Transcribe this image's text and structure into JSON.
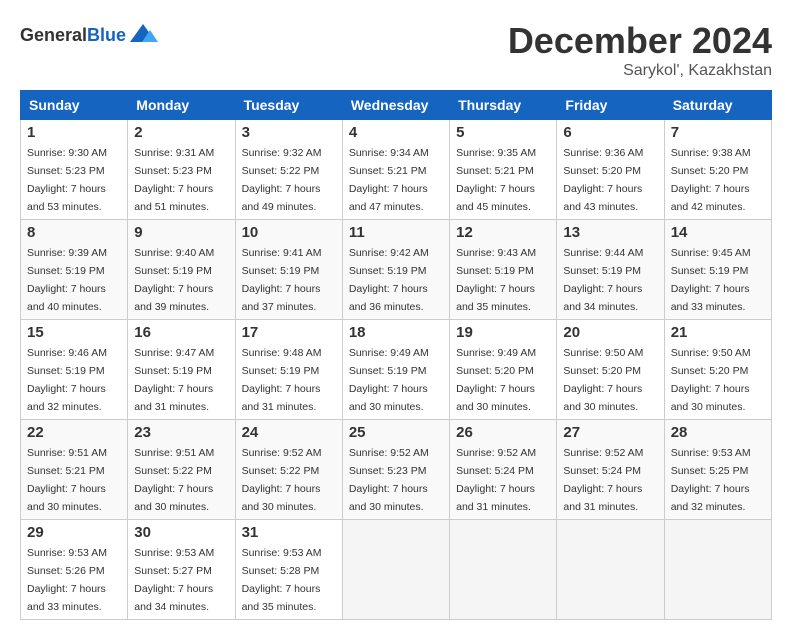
{
  "header": {
    "logo_general": "General",
    "logo_blue": "Blue",
    "title": "December 2024",
    "subtitle": "Sarykol', Kazakhstan"
  },
  "days_of_week": [
    "Sunday",
    "Monday",
    "Tuesday",
    "Wednesday",
    "Thursday",
    "Friday",
    "Saturday"
  ],
  "weeks": [
    [
      {
        "day": "1",
        "sunrise": "9:30 AM",
        "sunset": "5:23 PM",
        "daylight": "7 hours and 53 minutes."
      },
      {
        "day": "2",
        "sunrise": "9:31 AM",
        "sunset": "5:23 PM",
        "daylight": "7 hours and 51 minutes."
      },
      {
        "day": "3",
        "sunrise": "9:32 AM",
        "sunset": "5:22 PM",
        "daylight": "7 hours and 49 minutes."
      },
      {
        "day": "4",
        "sunrise": "9:34 AM",
        "sunset": "5:21 PM",
        "daylight": "7 hours and 47 minutes."
      },
      {
        "day": "5",
        "sunrise": "9:35 AM",
        "sunset": "5:21 PM",
        "daylight": "7 hours and 45 minutes."
      },
      {
        "day": "6",
        "sunrise": "9:36 AM",
        "sunset": "5:20 PM",
        "daylight": "7 hours and 43 minutes."
      },
      {
        "day": "7",
        "sunrise": "9:38 AM",
        "sunset": "5:20 PM",
        "daylight": "7 hours and 42 minutes."
      }
    ],
    [
      {
        "day": "8",
        "sunrise": "9:39 AM",
        "sunset": "5:19 PM",
        "daylight": "7 hours and 40 minutes."
      },
      {
        "day": "9",
        "sunrise": "9:40 AM",
        "sunset": "5:19 PM",
        "daylight": "7 hours and 39 minutes."
      },
      {
        "day": "10",
        "sunrise": "9:41 AM",
        "sunset": "5:19 PM",
        "daylight": "7 hours and 37 minutes."
      },
      {
        "day": "11",
        "sunrise": "9:42 AM",
        "sunset": "5:19 PM",
        "daylight": "7 hours and 36 minutes."
      },
      {
        "day": "12",
        "sunrise": "9:43 AM",
        "sunset": "5:19 PM",
        "daylight": "7 hours and 35 minutes."
      },
      {
        "day": "13",
        "sunrise": "9:44 AM",
        "sunset": "5:19 PM",
        "daylight": "7 hours and 34 minutes."
      },
      {
        "day": "14",
        "sunrise": "9:45 AM",
        "sunset": "5:19 PM",
        "daylight": "7 hours and 33 minutes."
      }
    ],
    [
      {
        "day": "15",
        "sunrise": "9:46 AM",
        "sunset": "5:19 PM",
        "daylight": "7 hours and 32 minutes."
      },
      {
        "day": "16",
        "sunrise": "9:47 AM",
        "sunset": "5:19 PM",
        "daylight": "7 hours and 31 minutes."
      },
      {
        "day": "17",
        "sunrise": "9:48 AM",
        "sunset": "5:19 PM",
        "daylight": "7 hours and 31 minutes."
      },
      {
        "day": "18",
        "sunrise": "9:49 AM",
        "sunset": "5:19 PM",
        "daylight": "7 hours and 30 minutes."
      },
      {
        "day": "19",
        "sunrise": "9:49 AM",
        "sunset": "5:20 PM",
        "daylight": "7 hours and 30 minutes."
      },
      {
        "day": "20",
        "sunrise": "9:50 AM",
        "sunset": "5:20 PM",
        "daylight": "7 hours and 30 minutes."
      },
      {
        "day": "21",
        "sunrise": "9:50 AM",
        "sunset": "5:20 PM",
        "daylight": "7 hours and 30 minutes."
      }
    ],
    [
      {
        "day": "22",
        "sunrise": "9:51 AM",
        "sunset": "5:21 PM",
        "daylight": "7 hours and 30 minutes."
      },
      {
        "day": "23",
        "sunrise": "9:51 AM",
        "sunset": "5:22 PM",
        "daylight": "7 hours and 30 minutes."
      },
      {
        "day": "24",
        "sunrise": "9:52 AM",
        "sunset": "5:22 PM",
        "daylight": "7 hours and 30 minutes."
      },
      {
        "day": "25",
        "sunrise": "9:52 AM",
        "sunset": "5:23 PM",
        "daylight": "7 hours and 30 minutes."
      },
      {
        "day": "26",
        "sunrise": "9:52 AM",
        "sunset": "5:24 PM",
        "daylight": "7 hours and 31 minutes."
      },
      {
        "day": "27",
        "sunrise": "9:52 AM",
        "sunset": "5:24 PM",
        "daylight": "7 hours and 31 minutes."
      },
      {
        "day": "28",
        "sunrise": "9:53 AM",
        "sunset": "5:25 PM",
        "daylight": "7 hours and 32 minutes."
      }
    ],
    [
      {
        "day": "29",
        "sunrise": "9:53 AM",
        "sunset": "5:26 PM",
        "daylight": "7 hours and 33 minutes."
      },
      {
        "day": "30",
        "sunrise": "9:53 AM",
        "sunset": "5:27 PM",
        "daylight": "7 hours and 34 minutes."
      },
      {
        "day": "31",
        "sunrise": "9:53 AM",
        "sunset": "5:28 PM",
        "daylight": "7 hours and 35 minutes."
      },
      null,
      null,
      null,
      null
    ]
  ]
}
